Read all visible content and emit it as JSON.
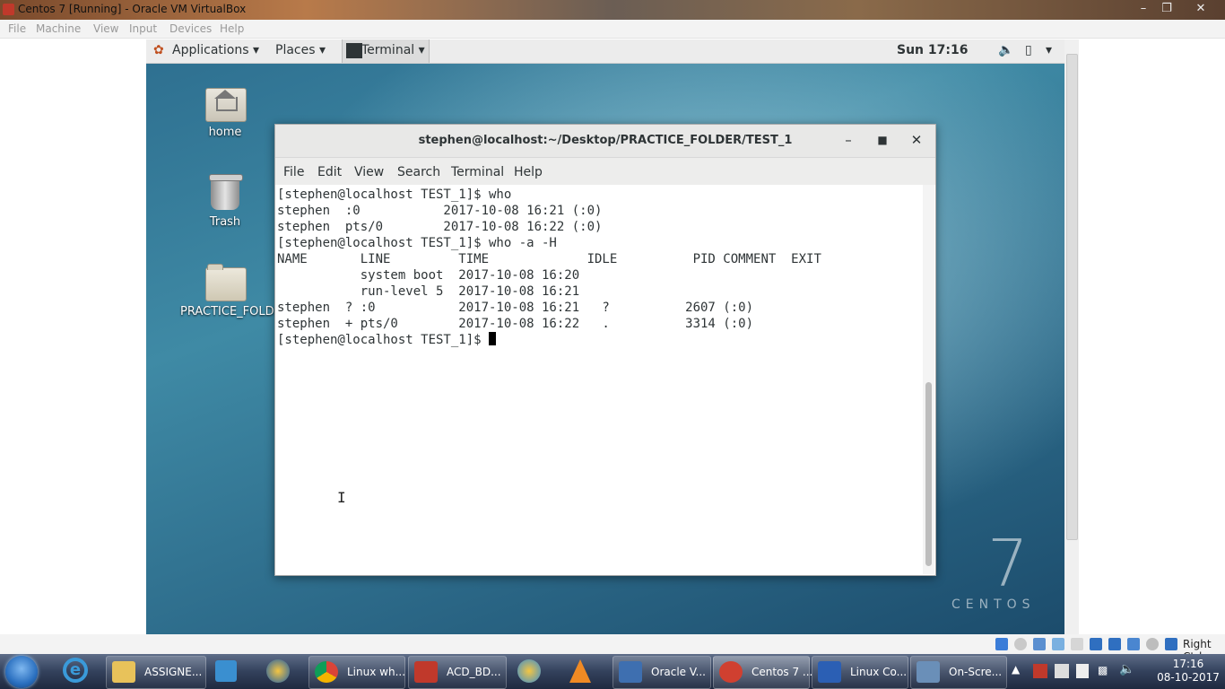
{
  "vbox": {
    "title": "Centos 7 [Running] - Oracle VM VirtualBox",
    "menu": [
      "File",
      "Machine",
      "View",
      "Input",
      "Devices",
      "Help"
    ],
    "status_host_key": "Right Ctrl"
  },
  "gnome": {
    "applications": "Applications",
    "places": "Places",
    "terminal": "Terminal",
    "clock": "Sun 17:16"
  },
  "desktop": {
    "icons": [
      {
        "label": "home",
        "icon": "home-folder-icon"
      },
      {
        "label": "Trash",
        "icon": "trash-icon"
      },
      {
        "label": "PRACTICE_FOLDE",
        "icon": "folder-icon"
      }
    ]
  },
  "terminal": {
    "title": "stephen@localhost:~/Desktop/PRACTICE_FOLDER/TEST_1",
    "menu": [
      "File",
      "Edit",
      "View",
      "Search",
      "Terminal",
      "Help"
    ],
    "lines": [
      "[stephen@localhost TEST_1]$ who",
      "stephen  :0           2017-10-08 16:21 (:0)",
      "stephen  pts/0        2017-10-08 16:22 (:0)",
      "[stephen@localhost TEST_1]$ who -a -H",
      "NAME       LINE         TIME             IDLE          PID COMMENT  EXIT",
      "           system boot  2017-10-08 16:20",
      "           run-level 5  2017-10-08 16:21",
      "stephen  ? :0           2017-10-08 16:21   ?          2607 (:0)",
      "stephen  + pts/0        2017-10-08 16:22   .          3314 (:0)"
    ],
    "prompt": "[stephen@localhost TEST_1]$ "
  },
  "centos_logo": {
    "numeral": "7",
    "word": "CENTOS"
  },
  "taskbar": {
    "buttons": [
      {
        "label": "ASSIGNE...",
        "icon": "folder-icon",
        "color": "#e8c25a"
      },
      {
        "label": "Linux wh...",
        "icon": "chrome-icon",
        "color": "#3a9b3a"
      },
      {
        "label": "ACD_BD...",
        "icon": "pdf-icon",
        "color": "#c0392b"
      },
      {
        "label": "Oracle V...",
        "icon": "virtualbox-icon",
        "color": "#3e6fb0"
      },
      {
        "label": "Centos 7 ...",
        "icon": "centos-vm-icon",
        "color": "#d04030"
      },
      {
        "label": "Linux Co...",
        "icon": "word-icon",
        "color": "#2b5fb4"
      },
      {
        "label": "On-Scre...",
        "icon": "keyboard-icon",
        "color": "#6a8fb8"
      }
    ],
    "time": "17:16",
    "date": "08-10-2017"
  }
}
